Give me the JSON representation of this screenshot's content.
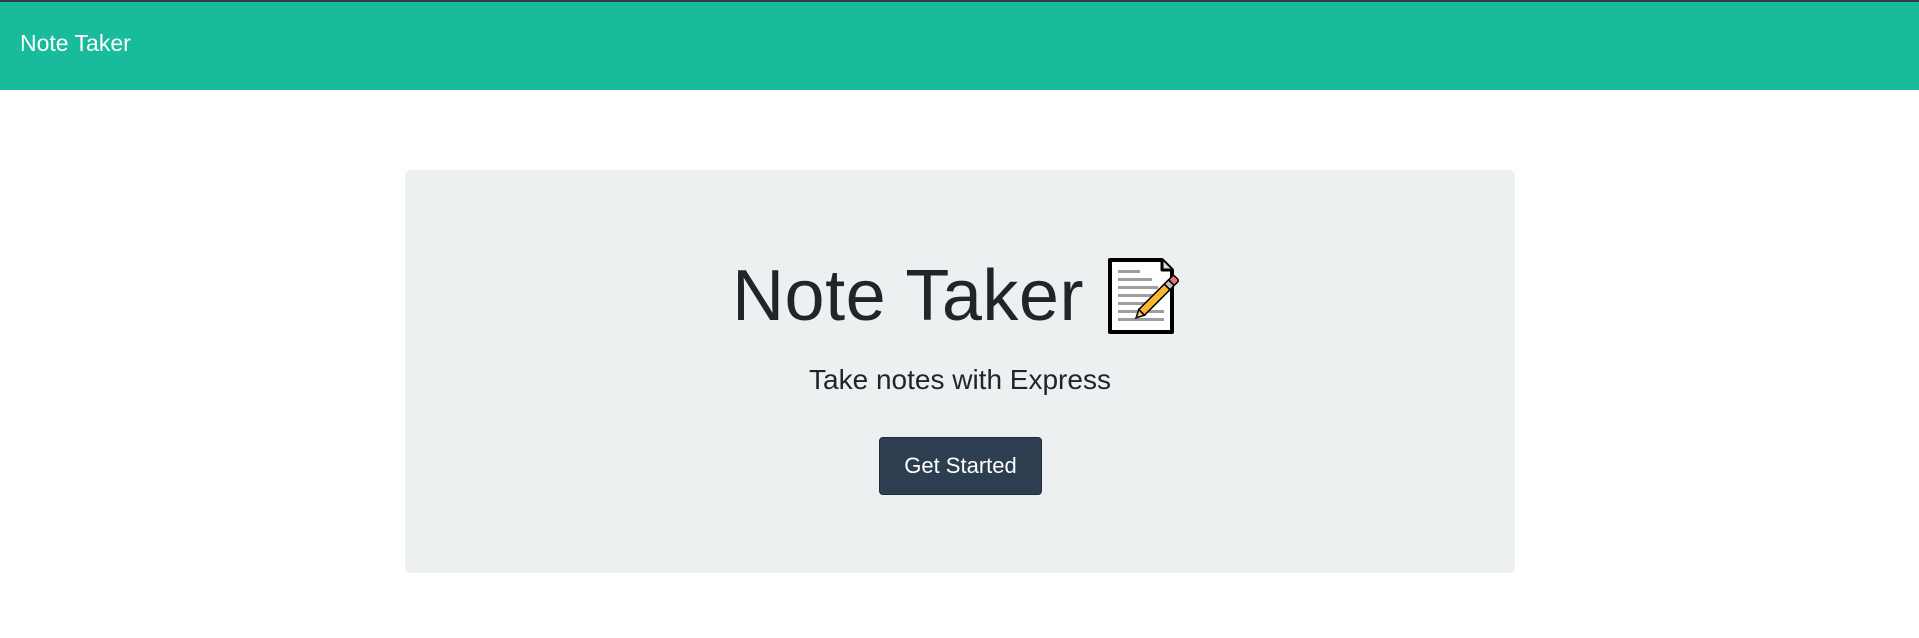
{
  "navbar": {
    "brand": "Note Taker",
    "background_color": "#18bc9c"
  },
  "hero": {
    "title": "Note Taker",
    "title_icon": "memo-icon",
    "subtitle": "Take notes with Express",
    "button_label": "Get Started",
    "button_color": "#2c3e50",
    "panel_color": "#ecf0f1"
  }
}
